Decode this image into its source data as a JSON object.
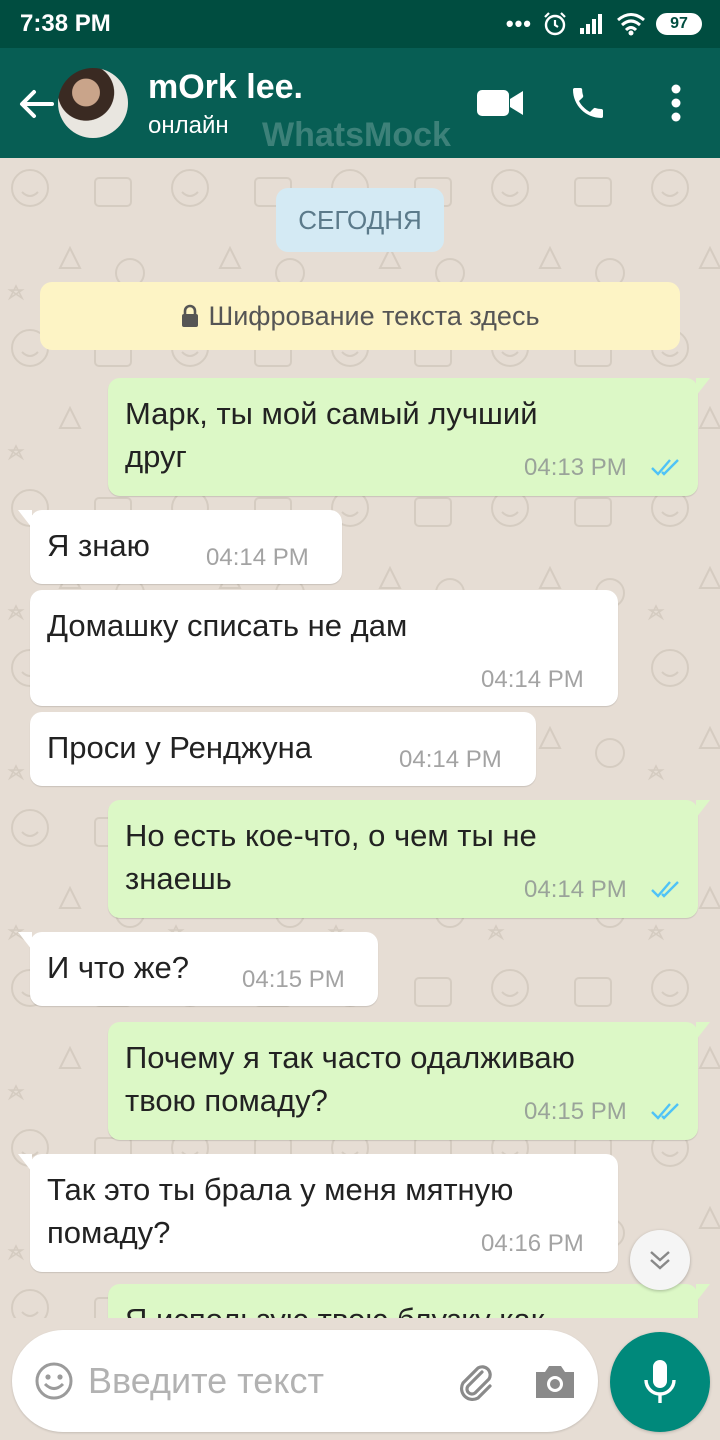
{
  "status_bar": {
    "time": "7:38 PM",
    "dots": "•••",
    "battery": "97"
  },
  "header": {
    "contact_name": "mOrk lee.",
    "contact_status": "онлайн",
    "watermark": "WhatsMock",
    "icons": [
      "back-arrow-icon",
      "video-call-icon",
      "phone-icon",
      "more-vert-icon"
    ]
  },
  "chat": {
    "date_chip": "СЕГОДНЯ",
    "encryption_notice": "Шифрование текста здесь",
    "messages": [
      {
        "direction": "out",
        "text_lines": [
          "Марк, ты мой самый лучший",
          "друг"
        ],
        "time": "04:13 PM",
        "read": true
      },
      {
        "direction": "in",
        "text_lines": [
          "Я знаю"
        ],
        "time": "04:14 PM"
      },
      {
        "direction": "in",
        "text_lines": [
          "Домашку списать не дам"
        ],
        "time": "04:14 PM"
      },
      {
        "direction": "in",
        "text_lines": [
          "Проси у Ренджуна"
        ],
        "time": "04:14 PM"
      },
      {
        "direction": "out",
        "text_lines": [
          "Но есть кое-что, о чем ты не",
          "знаешь"
        ],
        "time": "04:14 PM",
        "read": true
      },
      {
        "direction": "in",
        "text_lines": [
          "И что же?"
        ],
        "time": "04:15 PM"
      },
      {
        "direction": "out",
        "text_lines": [
          "Почему я так часто одалживаю",
          "твою помаду?"
        ],
        "time": "04:15 PM",
        "read": true
      },
      {
        "direction": "in",
        "text_lines": [
          "Так это ты брала у меня мятную",
          "помаду?"
        ],
        "time": "04:16 PM"
      },
      {
        "direction": "out",
        "text_lines": [
          "Я использую твою блузку как"
        ],
        "partially_hidden": true
      }
    ],
    "colors": {
      "out_bubble": "#dcf8c6",
      "in_bubble": "#ffffff",
      "read_ticks": "#4fc3f7",
      "header": "#075e54",
      "mic": "#00897b"
    }
  },
  "composer": {
    "placeholder": "Введите текст",
    "icons": [
      "emoji-icon",
      "attach-icon",
      "camera-icon",
      "mic-icon"
    ]
  }
}
